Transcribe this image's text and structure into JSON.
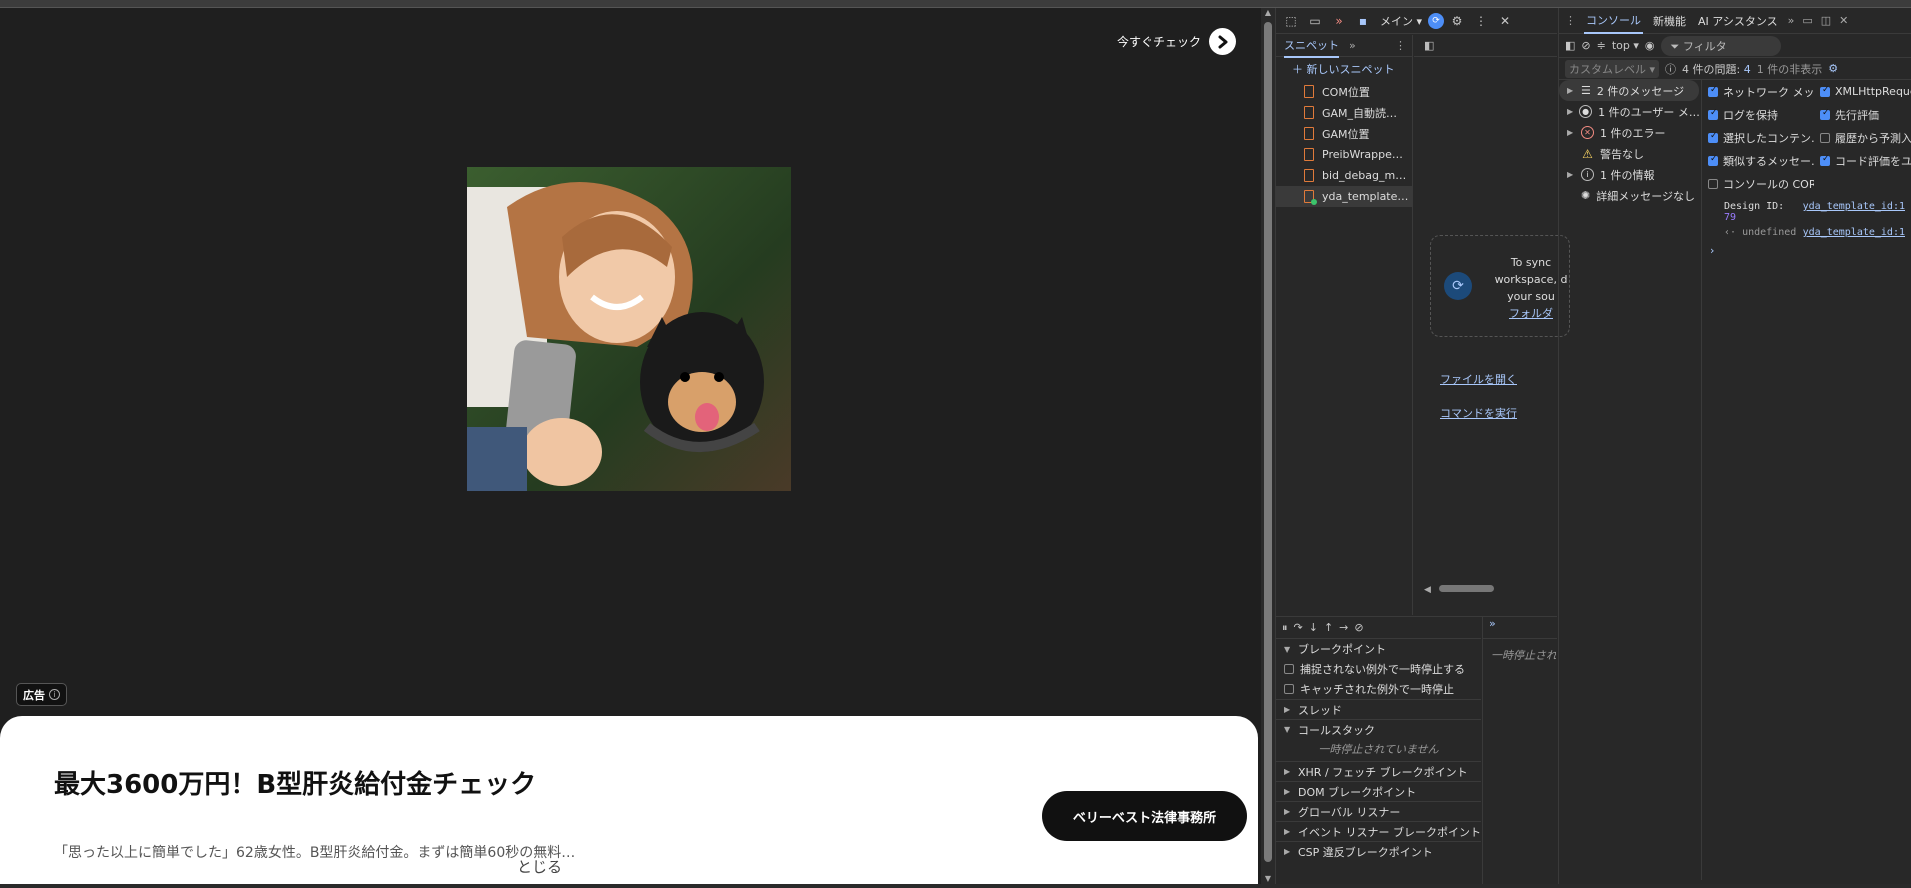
{
  "page": {
    "cta_label": "今すぐチェック",
    "ad_label": "広告",
    "ad_title": "最大3600万円！B型肝炎給付金チェック",
    "ad_description": "「思った以上に簡単でした」62歳女性。B型肝炎給付金。まずは簡単60秒の無料…",
    "close_label": "とじる",
    "advertiser_button": "ベリーベスト法律事務所"
  },
  "devtools": {
    "toolbar": {
      "main_label": "メイン ▾"
    },
    "snippets": {
      "tab_label": "スニペット",
      "new_snippet": "＋ 新しいスニペット",
      "items": [
        "COM位置",
        "GAM_自動読…",
        "GAM位置",
        "PreibWrappe…",
        "bid_debag_m…",
        "yda_template…"
      ]
    },
    "editor": {
      "sync_line1": "To sync",
      "sync_line2": "workspace, d",
      "sync_line3": "your sou",
      "sync_link": "フォルダ",
      "open_file": "ファイルを開く",
      "run_command": "コマンドを実行"
    },
    "debugger": {
      "breakpoints": "ブレークポイント",
      "pause_uncaught": "捕捉されない例外で一時停止する",
      "pause_caught": "キャッチされた例外で一時停止",
      "threads": "スレッド",
      "call_stack": "コールスタック",
      "not_paused": "一時停止されていません",
      "xhr": "XHR / フェッチ ブレークポイント",
      "dom": "DOM ブレークポイント",
      "global": "グローバル リスナー",
      "event": "イベント リスナー ブレークポイント",
      "csp": "CSP 違反ブレークポイント",
      "side_paused": "一時停止され"
    },
    "console": {
      "tabs": [
        "コンソール",
        "新機能",
        "AI アシスタンス"
      ],
      "context": "top ▾",
      "filter_placeholder": "フィルタ",
      "custom_level": "カスタムレベル ▾",
      "issues": "4 件の問題:",
      "issues_count": "4",
      "hidden": "1 件の非表示",
      "sidebar": [
        "2 件のメッセージ",
        "1 件のユーザー メ…",
        "1 件のエラー",
        "警告なし",
        "1 件の情報",
        "詳細メッセージなし"
      ],
      "options": [
        {
          "label": "ネットワーク メッセ…",
          "checked": true
        },
        {
          "label": "XMLHttpReque",
          "checked": true
        },
        {
          "label": "ログを保持",
          "checked": true
        },
        {
          "label": "先行評価",
          "checked": true
        },
        {
          "label": "選択したコンテン…",
          "checked": true
        },
        {
          "label": "履歴から予測入",
          "checked": false
        },
        {
          "label": "類似するメッセー…",
          "checked": true
        },
        {
          "label": "コード評価をユー…",
          "checked": true
        },
        {
          "label": "コンソールの COR…",
          "checked": false
        }
      ],
      "log": {
        "design_label": "Design ID:",
        "design_value": "79",
        "source1": "yda_template_id:1",
        "undefined": "undefined",
        "source2": "yda_template_id:1"
      }
    }
  }
}
